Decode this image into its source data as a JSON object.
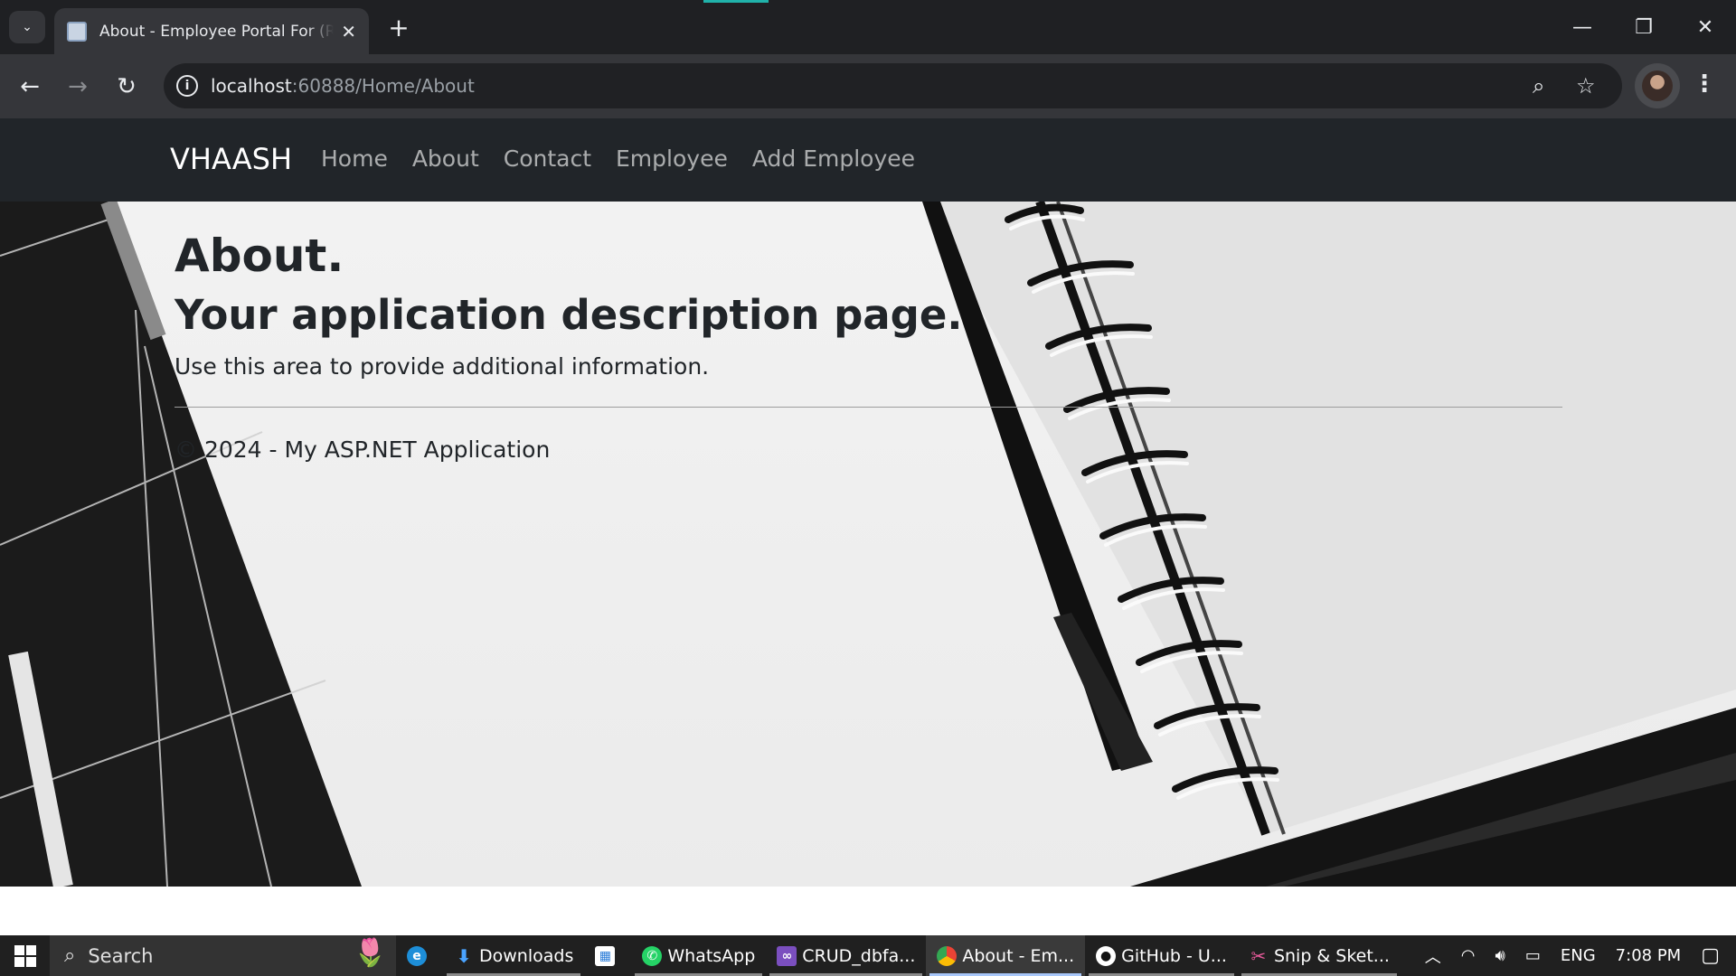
{
  "browser": {
    "tab_title": "About - Employee Portal For (R",
    "url_host": "localhost",
    "url_path": ":60888/Home/About",
    "icons": [
      "tab-search-icon",
      "favicon-icon",
      "close-icon",
      "plus-icon",
      "back-icon",
      "forward-icon",
      "reload-icon",
      "info-icon",
      "zoom-icon",
      "star-icon",
      "avatar",
      "kebab-menu-icon",
      "minimize-icon",
      "restore-icon",
      "close-window-icon"
    ]
  },
  "site": {
    "brand": "VHAASH",
    "nav": [
      "Home",
      "About",
      "Contact",
      "Employee",
      "Add Employee"
    ]
  },
  "main": {
    "heading": "About.",
    "subheading": "Your application description page.",
    "paragraph": "Use this area to provide additional information.",
    "footer": "© 2024 - My ASP.NET Application"
  },
  "taskbar": {
    "search_placeholder": "Search",
    "items": [
      {
        "label": "",
        "icon": "edge-icon"
      },
      {
        "label": "Downloads",
        "icon": "download-icon"
      },
      {
        "label": "",
        "icon": "store-icon"
      },
      {
        "label": "WhatsApp",
        "icon": "whatsapp-icon"
      },
      {
        "label": "CRUD_dbfa...",
        "icon": "visual-studio-icon"
      },
      {
        "label": "About - Em...",
        "icon": "chrome-icon"
      },
      {
        "label": "GitHub - U...",
        "icon": "github-icon"
      },
      {
        "label": "Snip & Sket...",
        "icon": "snip-icon"
      }
    ],
    "tray": {
      "language": "ENG",
      "time": "7:08 PM"
    }
  },
  "colors": {
    "navbar": "#212529",
    "browser_frame": "#1f2023",
    "toolbar": "#35363a",
    "accent_loading": "#20b2aa",
    "taskbar": "#202020"
  }
}
